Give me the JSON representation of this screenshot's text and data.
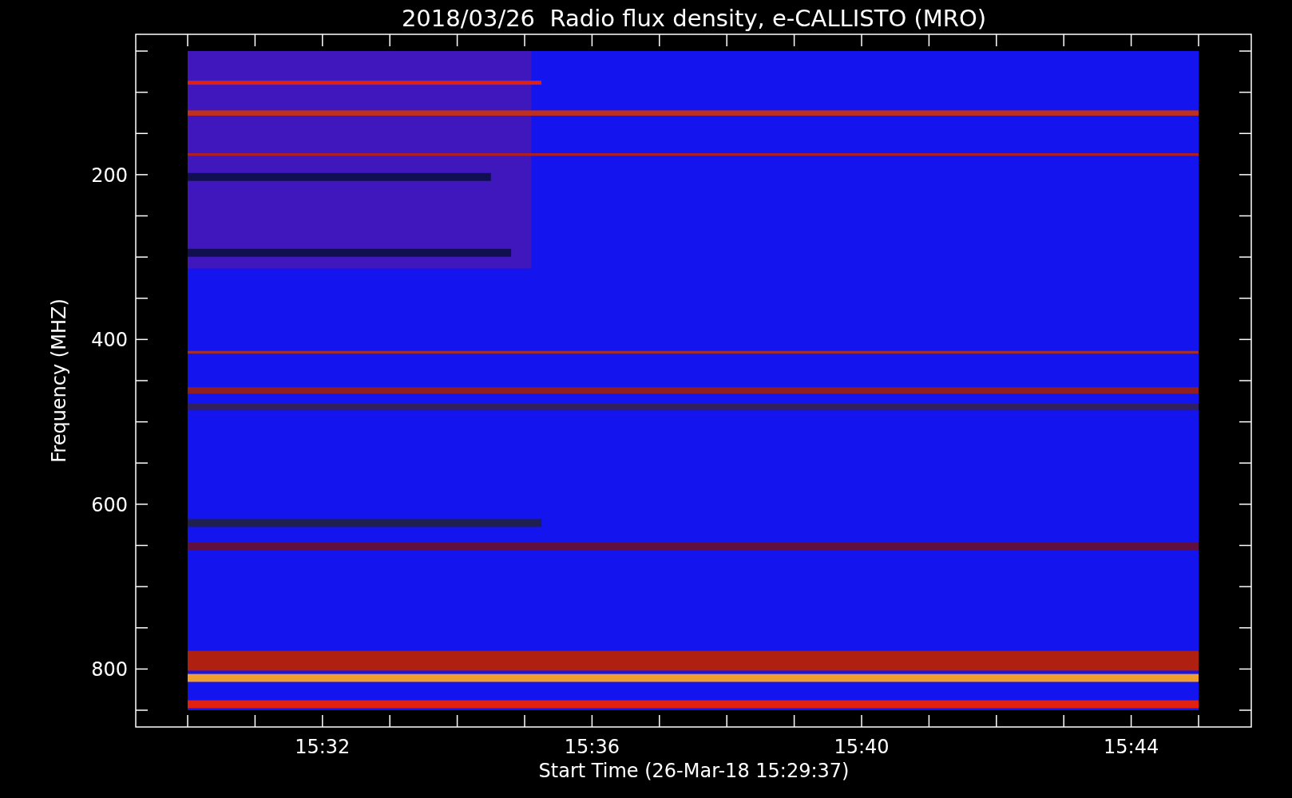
{
  "chart": {
    "title": "2018/03/26  Radio flux density, e-CALLISTO (MRO)",
    "ylabel": "Frequency (MHZ)",
    "xlabel": "Start Time (26-Mar-18 15:29:37)",
    "yticks": [
      "200",
      "400",
      "600",
      "800"
    ],
    "xticks": [
      "15:32",
      "15:36",
      "15:40",
      "15:44"
    ]
  }
}
